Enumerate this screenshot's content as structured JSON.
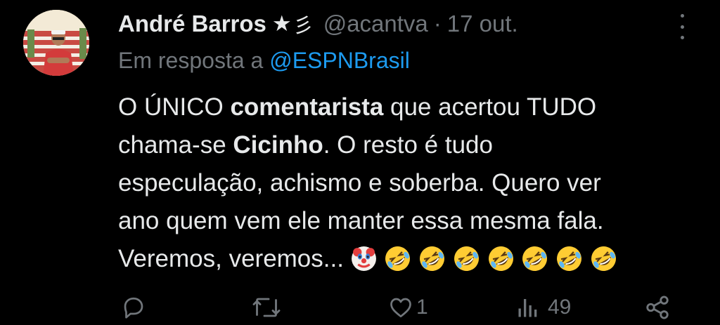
{
  "author": {
    "name": "André Barros",
    "badge_star": "★",
    "badge_wave": "彡",
    "handle": "@acantva",
    "separator": "·",
    "date": "17 out."
  },
  "reply_to": {
    "prefix": "Em resposta a",
    "mention": "@ESPNBrasil"
  },
  "tweet": {
    "line1_a": "O ÚNICO ",
    "line1_b": "comentarista",
    "line1_c": " que acertou TUDO",
    "line2_a": "chama-se ",
    "line2_b": "Cicinho",
    "line2_c": ". O resto é tudo",
    "line3": "especulação, achismo e soberba. Quero ver",
    "line4": "ano quem vem ele manter essa mesma fala.",
    "line5": "Veremos, veremos...",
    "emojis": [
      "clown-face",
      "rolling-on-floor-laughing",
      "rolling-on-floor-laughing",
      "rolling-on-floor-laughing",
      "rolling-on-floor-laughing",
      "rolling-on-floor-laughing",
      "rolling-on-floor-laughing",
      "rolling-on-floor-laughing"
    ]
  },
  "actions": {
    "reply_icon": "reply-icon",
    "retweet_icon": "retweet-icon",
    "like_icon": "heart-icon",
    "like_count": "1",
    "views_icon": "views-icon",
    "views_count": "49",
    "share_icon": "share-icon"
  },
  "colors": {
    "background": "#000000",
    "text": "#e7e9ea",
    "muted": "#71767b",
    "link": "#1d9bf0"
  }
}
